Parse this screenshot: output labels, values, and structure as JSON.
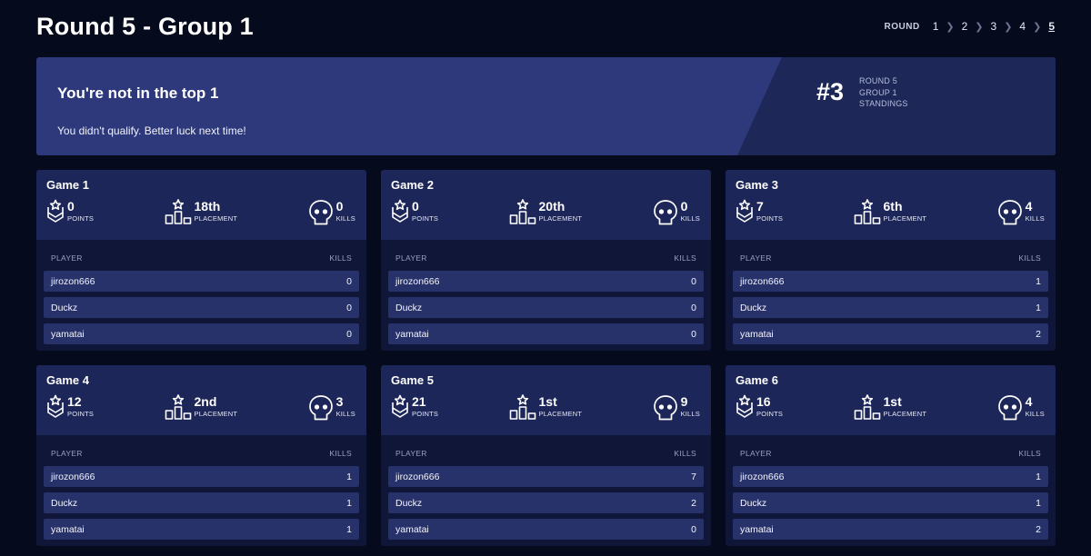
{
  "page": {
    "title": "Round 5 - Group 1"
  },
  "round_nav": {
    "label": "ROUND",
    "rounds": [
      "1",
      "2",
      "3",
      "4",
      "5"
    ],
    "active": "5"
  },
  "banner": {
    "title": "You're not in the top 1",
    "message": "You didn't qualify. Better luck next time!",
    "rank": "#3",
    "meta": [
      "ROUND 5",
      "GROUP 1",
      "STANDINGS"
    ]
  },
  "labels": {
    "points": "POINTS",
    "placement": "PLACEMENT",
    "kills": "KILLS",
    "player_col": "PLAYER",
    "kills_col": "KILLS"
  },
  "games": [
    {
      "title": "Game 1",
      "points": "0",
      "placement": "18th",
      "kills": "0",
      "players": [
        {
          "name": "jirozon666",
          "kills": "0"
        },
        {
          "name": "Duckz",
          "kills": "0"
        },
        {
          "name": "yamatai",
          "kills": "0"
        }
      ]
    },
    {
      "title": "Game 2",
      "points": "0",
      "placement": "20th",
      "kills": "0",
      "players": [
        {
          "name": "jirozon666",
          "kills": "0"
        },
        {
          "name": "Duckz",
          "kills": "0"
        },
        {
          "name": "yamatai",
          "kills": "0"
        }
      ]
    },
    {
      "title": "Game 3",
      "points": "7",
      "placement": "6th",
      "kills": "4",
      "players": [
        {
          "name": "jirozon666",
          "kills": "1"
        },
        {
          "name": "Duckz",
          "kills": "1"
        },
        {
          "name": "yamatai",
          "kills": "2"
        }
      ]
    },
    {
      "title": "Game 4",
      "points": "12",
      "placement": "2nd",
      "kills": "3",
      "players": [
        {
          "name": "jirozon666",
          "kills": "1"
        },
        {
          "name": "Duckz",
          "kills": "1"
        },
        {
          "name": "yamatai",
          "kills": "1"
        }
      ]
    },
    {
      "title": "Game 5",
      "points": "21",
      "placement": "1st",
      "kills": "9",
      "players": [
        {
          "name": "jirozon666",
          "kills": "7"
        },
        {
          "name": "Duckz",
          "kills": "2"
        },
        {
          "name": "yamatai",
          "kills": "0"
        }
      ]
    },
    {
      "title": "Game 6",
      "points": "16",
      "placement": "1st",
      "kills": "4",
      "players": [
        {
          "name": "jirozon666",
          "kills": "1"
        },
        {
          "name": "Duckz",
          "kills": "1"
        },
        {
          "name": "yamatai",
          "kills": "2"
        }
      ]
    }
  ],
  "colors": {
    "background": "#050b1d",
    "banner": "#2d397a",
    "card": "#0f1637",
    "card_header": "#1d2658",
    "row": "#27316a"
  },
  "icons": {
    "points": "chevron-rank-icon",
    "placement": "podium-icon",
    "kills": "skull-icon"
  }
}
